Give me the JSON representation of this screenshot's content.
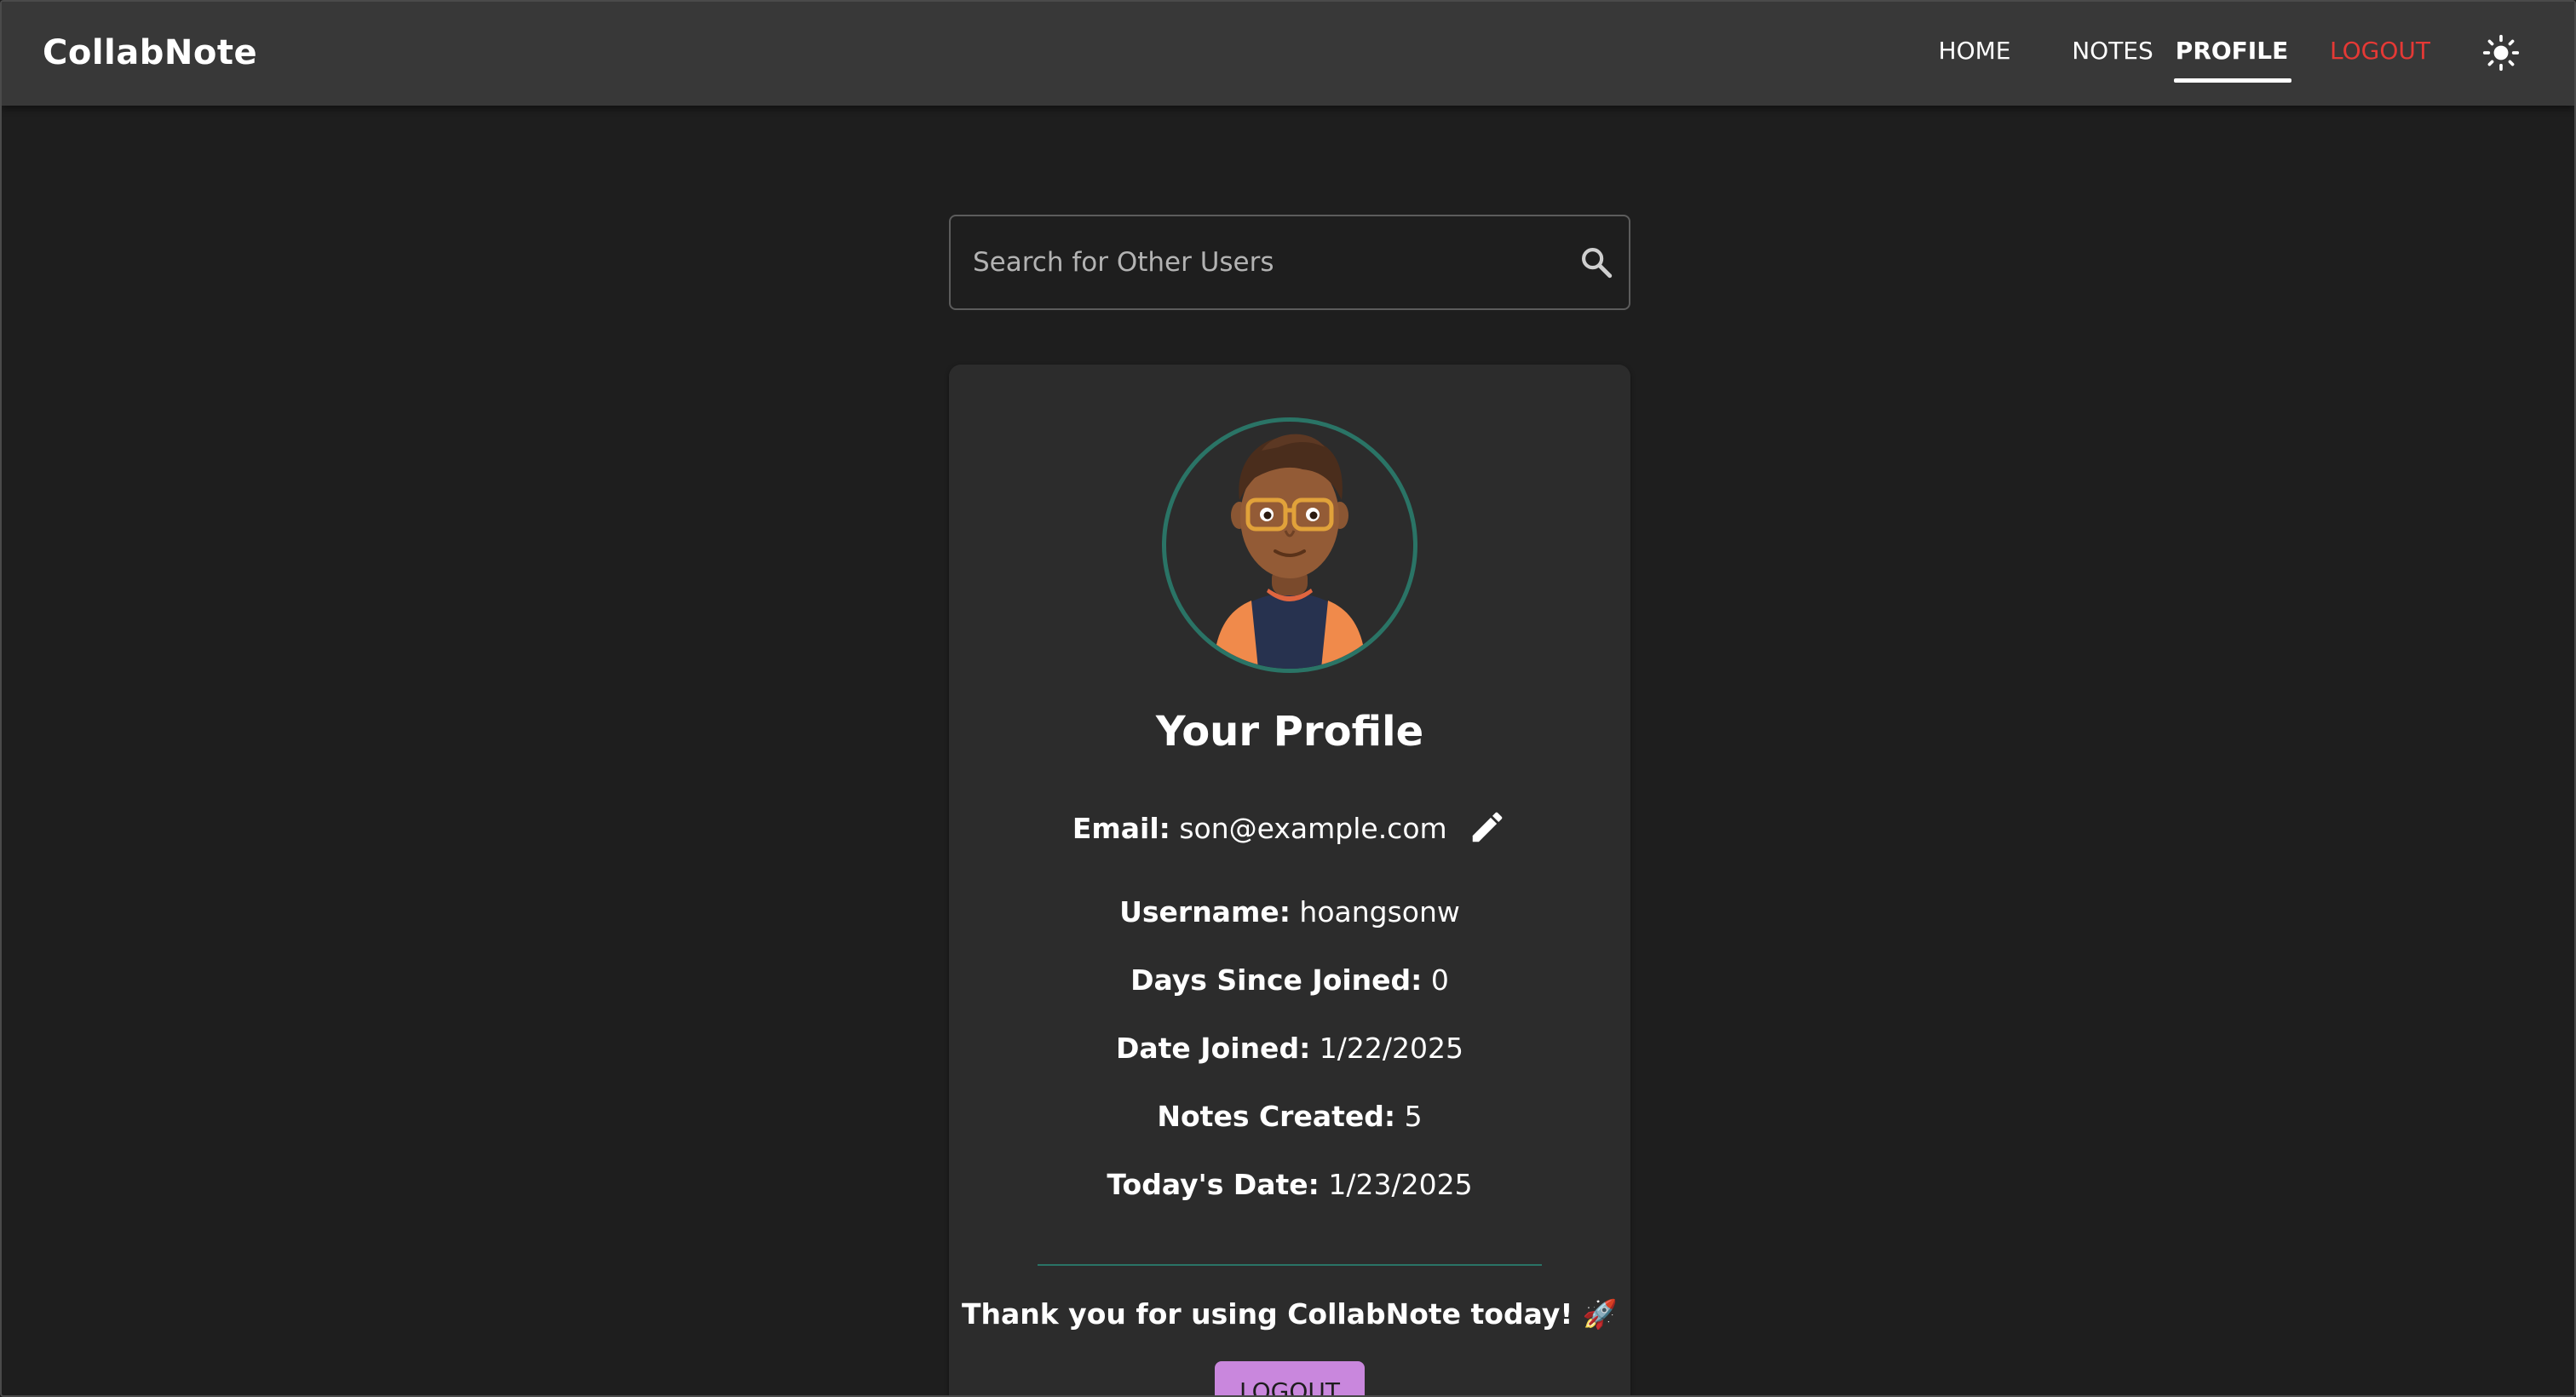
{
  "app": {
    "brand": "CollabNote"
  },
  "nav": {
    "items": [
      {
        "label": "HOME"
      },
      {
        "label": "NOTES"
      },
      {
        "label": "PROFILE",
        "active": true
      },
      {
        "label": "LOGOUT"
      }
    ],
    "theme_toggle_icon": "sun-icon",
    "logout_color": "#e53935"
  },
  "search": {
    "placeholder": "Search for Other Users",
    "value": "",
    "icon": "search-icon"
  },
  "profile": {
    "avatar_icon": "memoji-avatar",
    "title": "Your Profile",
    "email_label": "Email:",
    "email_value": "son@example.com",
    "edit_icon": "pencil-icon",
    "fields": [
      {
        "label": "Username:",
        "value": "hoangsonw"
      },
      {
        "label": "Days Since Joined:",
        "value": "0"
      },
      {
        "label": "Date Joined:",
        "value": "1/22/2025"
      },
      {
        "label": "Notes Created:",
        "value": "5"
      },
      {
        "label": "Today's Date:",
        "value": "1/23/2025"
      }
    ],
    "thanks": "Thank you for using CollabNote today! 🚀",
    "logout_button": "LOGOUT",
    "accent": "#2a7466",
    "button_color": "#c987dd"
  }
}
